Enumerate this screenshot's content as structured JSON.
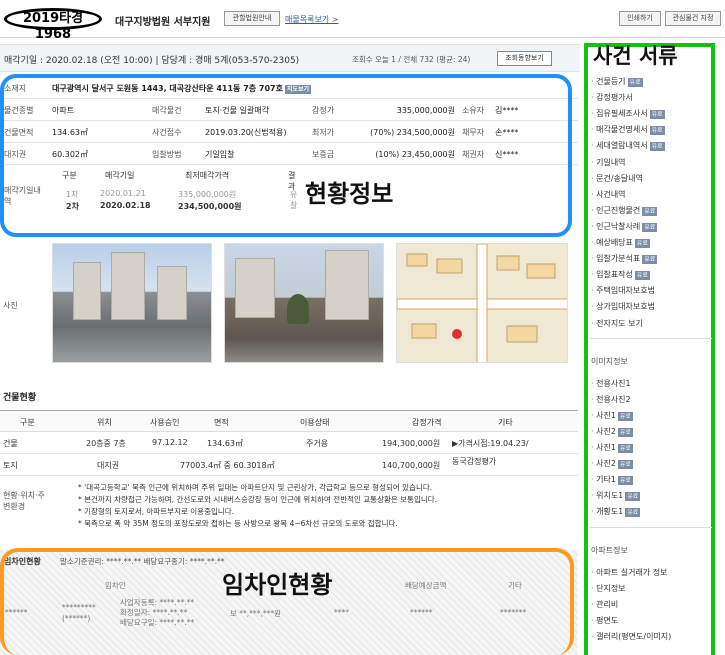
{
  "header": {
    "case_number": "2019타경1968",
    "court": "대구지방법원 서부지원",
    "court_info_btn": "관할법원안내",
    "sale_list_link": "매물목록보기 >",
    "print_btn": "인쇄하기",
    "interest_btn": "관심물건 지정"
  },
  "info_bar": {
    "text": "매각기일 : 2020.02.18 (오전 10:00) | 담당계 : 경매 5계(053-570-2305)",
    "views": "조회수 오늘 1 / 전체 732 (평균: 24)",
    "views_btn": "조회동향보기"
  },
  "overview": {
    "address_label": "소재지",
    "address": "대구광역시 달서구 도원동 1443, 대곡강산타운 411동 7층 707호",
    "map_tag": "지도보기",
    "rows": [
      {
        "l1": "물건종별",
        "v1": "아파트",
        "l2": "매각물건",
        "v2": "토지·건물 일괄매각",
        "l3": "감정가",
        "v3": "335,000,000원",
        "l4": "소유자",
        "v4": "김****"
      },
      {
        "l1": "건물면적",
        "v1": "134.63㎡",
        "l2": "사건접수",
        "v2": "2019.03.20(신법적용)",
        "l3": "최저가",
        "v3": "(70%) 234,500,000원",
        "l4": "채무자",
        "v4": "손****"
      },
      {
        "l1": "대지권",
        "v1": "60.302㎡",
        "l2": "입찰방법",
        "v2": "기일입찰",
        "l3": "보증금",
        "v3": "(10%) 23,450,000원",
        "l4": "채권자",
        "v4": "신****"
      }
    ],
    "history_label": "매각기일내역",
    "history_headers": [
      "구분",
      "매각기일",
      "최저매각가격",
      "결과"
    ],
    "history_rows": [
      [
        "1차",
        "2020.01.21",
        "335,000,000원",
        "유찰"
      ],
      [
        "2차",
        "2020.02.18",
        "234,500,000원",
        ""
      ]
    ],
    "annotation": "현황정보"
  },
  "photos": {
    "label": "사진"
  },
  "building": {
    "title": "건물현황",
    "headers": [
      "구분",
      "위치",
      "사용승인",
      "면적",
      "이용상태",
      "감정가격",
      "기타"
    ],
    "rows": [
      [
        "건물",
        "20층중 7층",
        "97.12.12",
        "134.63㎡",
        "주거용",
        "194,300,000원",
        "▶가격시점:19.04.23/"
      ],
      [
        "토지",
        "대지권",
        "",
        "77003.4㎡ 중 60.3018㎡",
        "",
        "140,700,000원",
        "동국감정평가"
      ]
    ],
    "notes_label": "현황·위치·주변환경",
    "notes": [
      "* '대곡고등학교' 북측 인근에 위치하며 주위 일대는 아파트단지 및 근린상가, 각급학교 등으로 형성되어 있습니다.",
      "* 본건까지 차량접근 가능하며, 간선도로와 시내버스승강장 등이 인근에 위치하여 전반적인 교통상황은 보통입니다.",
      "* 기장형의 토지로서, 아파트부지로 이용중입니다.",
      "* 북측으로 폭 약 35M 정도의 포장도로와 접하는 등 사방으로 왕복 4~6차선 규모의 도로와 접합니다."
    ]
  },
  "tenants": {
    "title": "임차인현황",
    "sub": "말소기준권리: ****.**.**  배당요구종기: ****.**.**",
    "annotation": "임차인현황",
    "col_tenant": "임차인",
    "col_dividend": "배당예상금액",
    "col_etc": "기타",
    "row": [
      "******",
      "*********\n(******)",
      "사업자등록: ****.**.**\n확정일자: ****.**.**\n배당요구일: ****.**.**",
      "보 **,***,***원",
      "****",
      "******",
      "*******"
    ]
  },
  "sidebar": {
    "title": "사건 서류",
    "items": [
      {
        "label": "건물등기",
        "tag": "유료"
      },
      {
        "label": "감정평가서",
        "tag": ""
      },
      {
        "label": "집유필세조사서",
        "tag": "유료"
      },
      {
        "label": "매각물건명세서",
        "tag": "유료"
      },
      {
        "label": "세대열람내역서",
        "tag": "유료"
      },
      {
        "label": "기일내역",
        "tag": ""
      },
      {
        "label": "문건/송달내역",
        "tag": ""
      },
      {
        "label": "사건내역",
        "tag": ""
      },
      {
        "label": "인근진행물건",
        "tag": "유료"
      },
      {
        "label": "인근낙찰사례",
        "tag": "유료"
      },
      {
        "label": "예상배당표",
        "tag": "유료"
      },
      {
        "label": "입찰가분석표",
        "tag": "유료"
      },
      {
        "label": "입찰표작성",
        "tag": "유료"
      },
      {
        "label": "주택임대차보호법",
        "tag": ""
      },
      {
        "label": "상가임대차보호법",
        "tag": ""
      },
      {
        "label": "전자지도 보기",
        "tag": ""
      }
    ],
    "image_section": "이미지정보",
    "image_items": [
      {
        "label": "전용사진1",
        "tag": ""
      },
      {
        "label": "전용사진2",
        "tag": ""
      },
      {
        "label": "사진1",
        "tag": "유료"
      },
      {
        "label": "사진2",
        "tag": "유료"
      },
      {
        "label": "사진1",
        "tag": "유료"
      },
      {
        "label": "사진2",
        "tag": "유료"
      },
      {
        "label": "기타1",
        "tag": "유료"
      },
      {
        "label": "위치도1",
        "tag": "유료"
      },
      {
        "label": "개황도1",
        "tag": "유료"
      }
    ],
    "apt_section": "아파트정보",
    "apt_items": [
      {
        "label": "아파트 실거래가 정보"
      },
      {
        "label": "단지정보"
      },
      {
        "label": "관리비"
      },
      {
        "label": "평면도"
      },
      {
        "label": "갤러리(평면도/이미지)"
      }
    ]
  }
}
